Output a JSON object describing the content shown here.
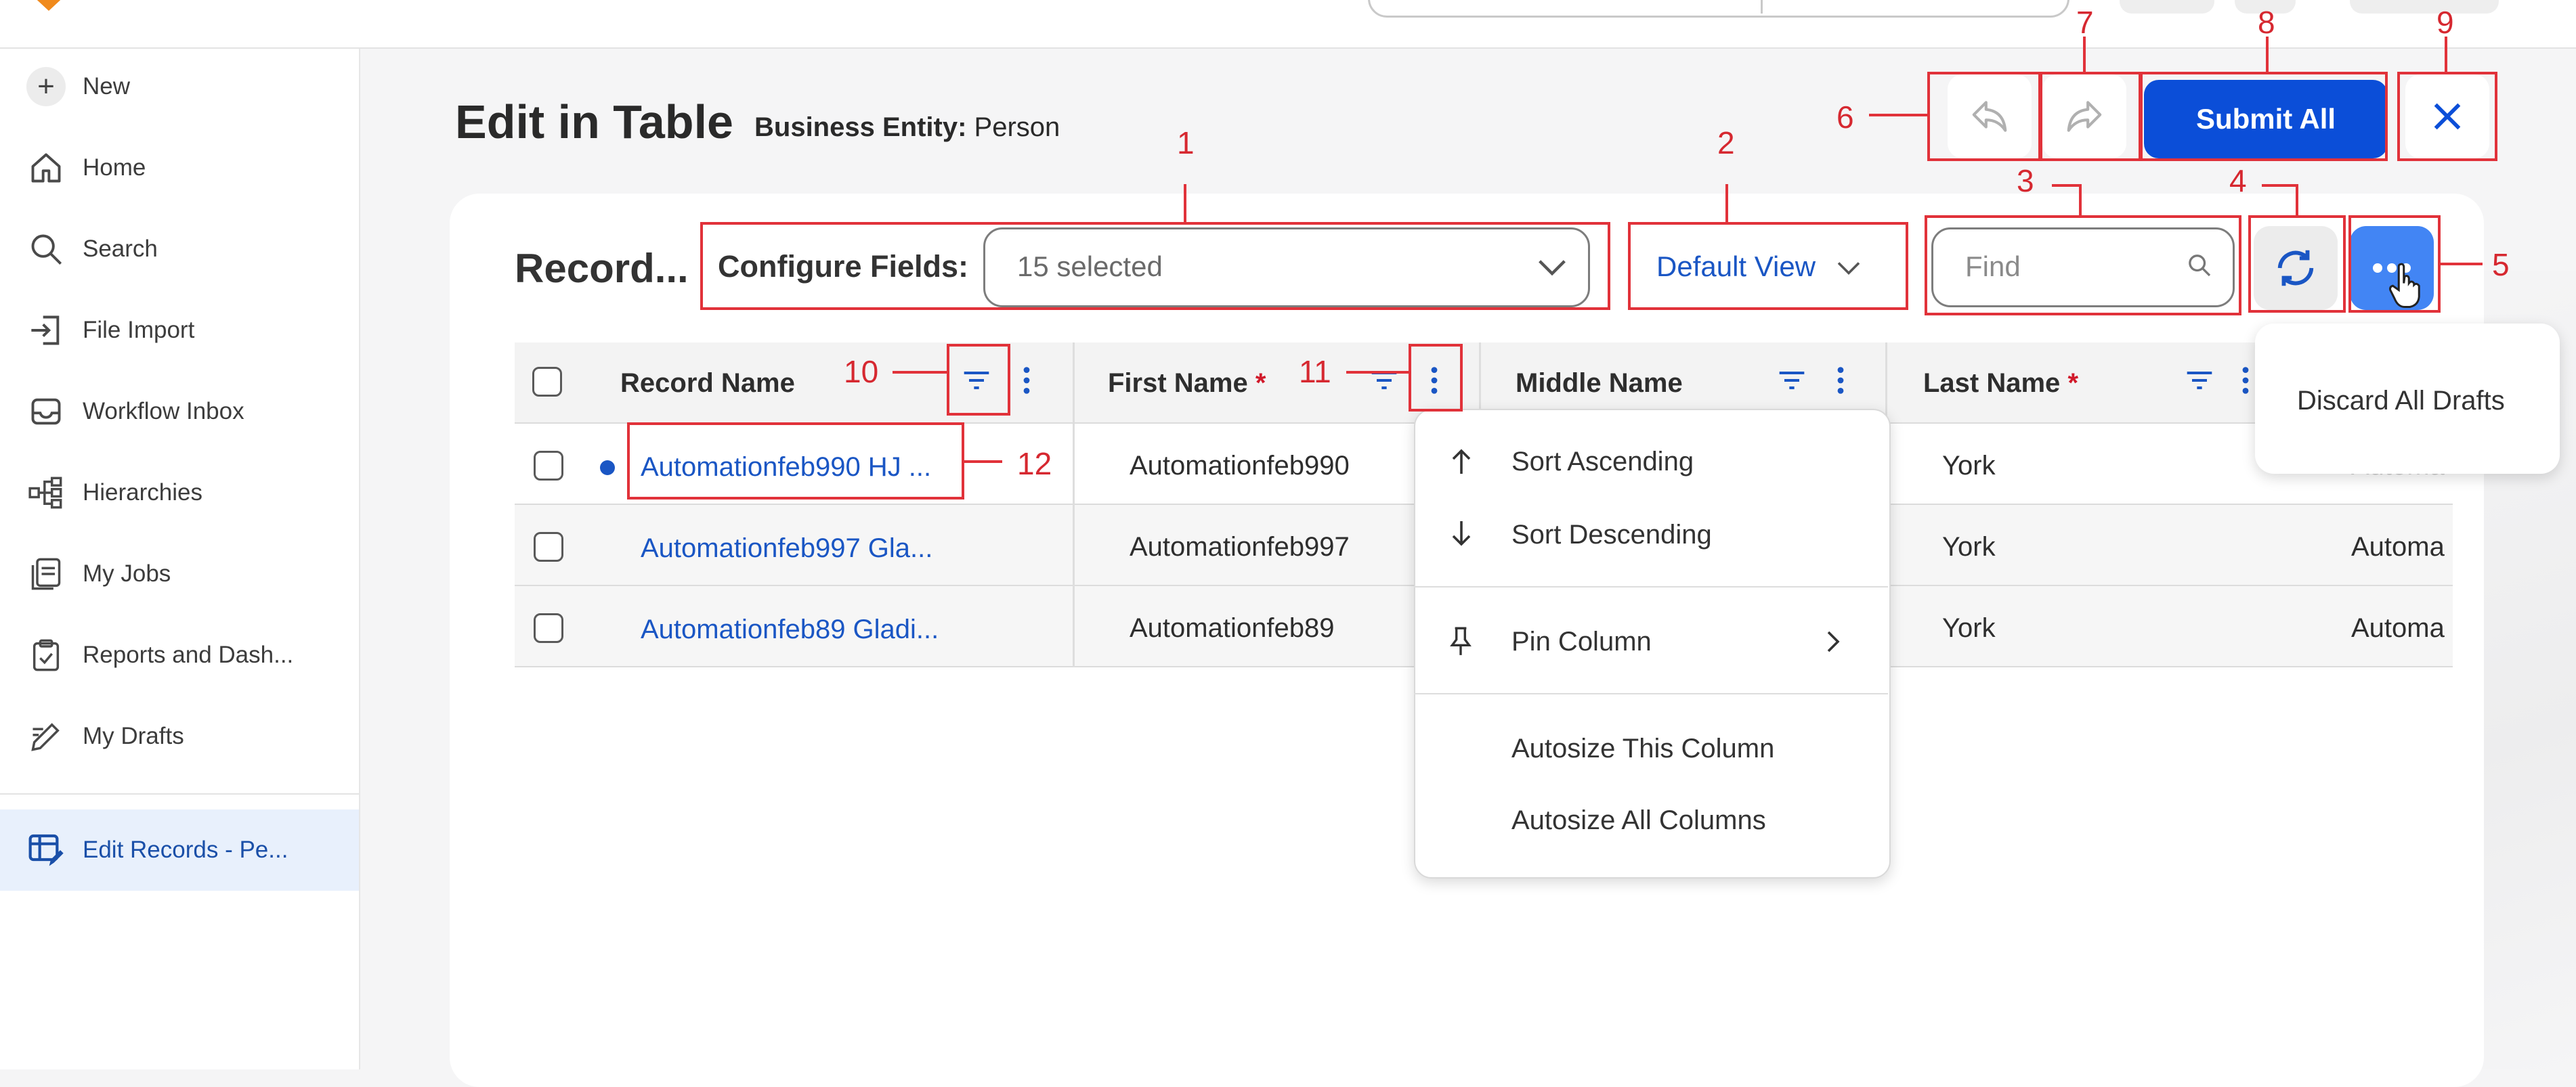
{
  "sidebar": {
    "items": [
      {
        "label": "New",
        "icon": "plus-icon"
      },
      {
        "label": "Home",
        "icon": "home-icon"
      },
      {
        "label": "Search",
        "icon": "search-icon"
      },
      {
        "label": "File Import",
        "icon": "file-import-icon"
      },
      {
        "label": "Workflow Inbox",
        "icon": "inbox-icon"
      },
      {
        "label": "Hierarchies",
        "icon": "hierarchy-icon"
      },
      {
        "label": "My Jobs",
        "icon": "jobs-icon"
      },
      {
        "label": "Reports and Dash...",
        "icon": "report-icon"
      },
      {
        "label": "My Drafts",
        "icon": "drafts-icon"
      },
      {
        "label": "Edit Records - Pe...",
        "icon": "table-edit-icon",
        "active": true
      }
    ]
  },
  "header": {
    "title": "Edit in Table",
    "entity_label": "Business Entity:",
    "entity_value": "Person",
    "submit_label": "Submit All"
  },
  "toolbar": {
    "records_title": "Record...",
    "configure_label": "Configure Fields:",
    "configure_value": "15 selected",
    "view_label": "Default View",
    "find_placeholder": "Find"
  },
  "table": {
    "columns": [
      {
        "label": "Record Name",
        "required": false
      },
      {
        "label": "First Name",
        "required": true
      },
      {
        "label": "Middle Name",
        "required": false
      },
      {
        "label": "Last Name",
        "required": true
      }
    ],
    "rows": [
      {
        "record": "Automationfeb990 HJ ...",
        "first": "Automationfeb990",
        "last": "York",
        "extra": "Automa",
        "draft": true
      },
      {
        "record": "Automationfeb997 Gla...",
        "first": "Automationfeb997",
        "last": "York",
        "extra": "Automa",
        "draft": false
      },
      {
        "record": "Automationfeb89 Gladi...",
        "first": "Automationfeb89",
        "last": "York",
        "extra": "Automa",
        "draft": false
      }
    ]
  },
  "column_menu": {
    "sort_asc": "Sort Ascending",
    "sort_desc": "Sort Descending",
    "pin": "Pin Column",
    "autosize_this": "Autosize This Column",
    "autosize_all": "Autosize All Columns"
  },
  "more_menu": {
    "discard": "Discard All Drafts"
  },
  "annotations": [
    "1",
    "2",
    "3",
    "4",
    "5",
    "6",
    "7",
    "8",
    "9",
    "10",
    "11",
    "12"
  ],
  "colors": {
    "accent": "#0b4ed8",
    "link": "#1a56c4",
    "annotation": "#e1323a",
    "active_nav": "#e8f0fc"
  }
}
